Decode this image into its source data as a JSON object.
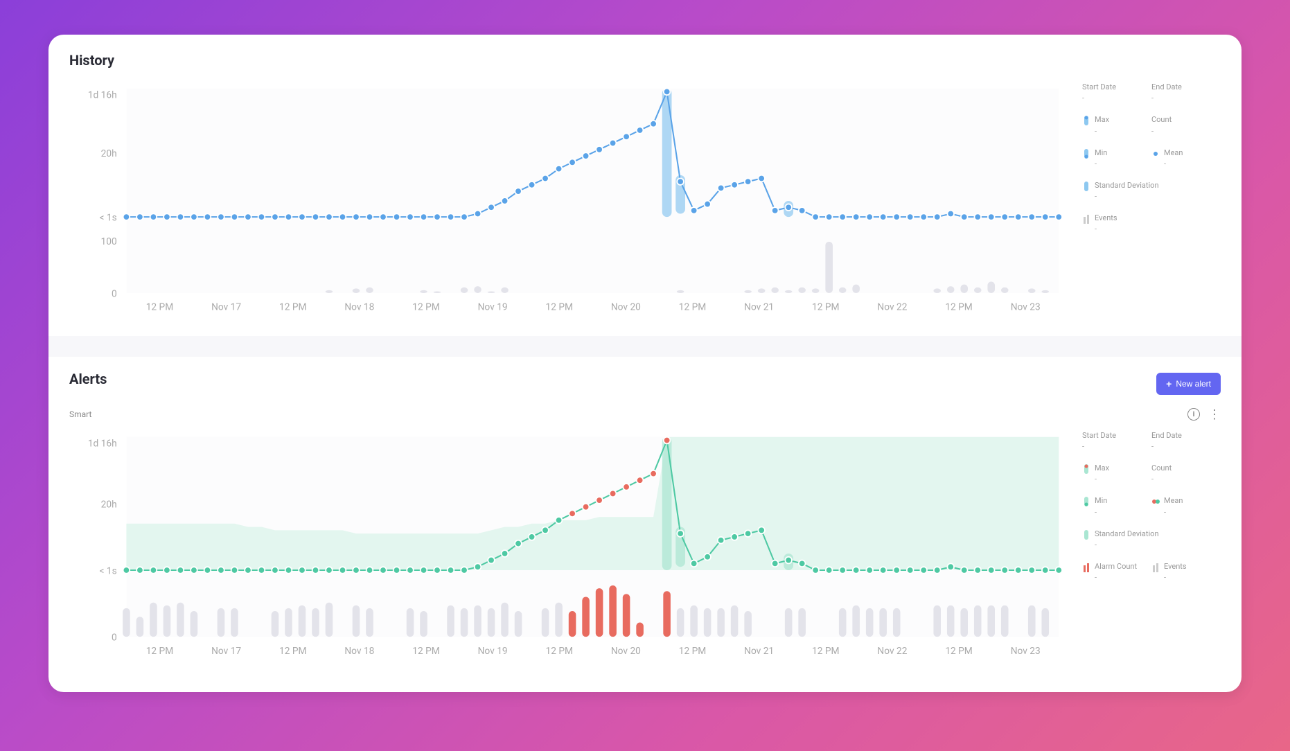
{
  "history": {
    "title": "History",
    "stats": {
      "start_date": {
        "label": "Start Date",
        "value": "-"
      },
      "end_date": {
        "label": "End Date",
        "value": "-"
      },
      "max": {
        "label": "Max",
        "value": "-"
      },
      "count": {
        "label": "Count",
        "value": "-"
      },
      "min": {
        "label": "Min",
        "value": "-"
      },
      "mean": {
        "label": "Mean",
        "value": "-"
      },
      "stddev": {
        "label": "Standard Deviation",
        "value": "-"
      },
      "events": {
        "label": "Events",
        "value": "-"
      }
    }
  },
  "alerts": {
    "title": "Alerts",
    "new_alert_label": "New alert",
    "subheader": "Smart",
    "stats": {
      "start_date": {
        "label": "Start Date",
        "value": "-"
      },
      "end_date": {
        "label": "End Date",
        "value": "-"
      },
      "max": {
        "label": "Max",
        "value": "-"
      },
      "count": {
        "label": "Count",
        "value": "-"
      },
      "min": {
        "label": "Min",
        "value": "-"
      },
      "mean": {
        "label": "Mean",
        "value": "-"
      },
      "stddev": {
        "label": "Standard Deviation",
        "value": "-"
      },
      "alarm_count": {
        "label": "Alarm Count",
        "value": "-"
      },
      "events": {
        "label": "Events",
        "value": "-"
      }
    }
  },
  "chart_data": [
    {
      "type": "line",
      "title": "History",
      "x_labels": [
        "12 PM",
        "Nov 17",
        "12 PM",
        "Nov 18",
        "12 PM",
        "Nov 19",
        "12 PM",
        "Nov 20",
        "12 PM",
        "Nov 21",
        "12 PM",
        "Nov 22",
        "12 PM",
        "Nov 23"
      ],
      "y_ticks": [
        "1d 16h",
        "20h",
        "< 1s"
      ],
      "events_y_ticks": [
        100,
        0
      ],
      "series": [
        {
          "name": "Mean (hours)",
          "color": "#5aa3e8",
          "values": [
            0,
            0,
            0,
            0,
            0,
            0,
            0,
            0,
            0,
            0,
            0,
            0,
            0,
            0,
            0,
            0,
            0,
            0,
            0,
            0,
            0,
            0,
            0,
            0,
            0,
            0,
            1,
            3,
            5,
            8,
            10,
            12,
            15,
            17,
            19,
            21,
            23,
            25,
            27,
            29,
            39,
            11,
            2,
            4,
            9,
            10,
            11,
            12,
            2,
            3,
            2,
            0,
            0,
            0,
            0,
            0,
            0,
            0,
            0,
            0,
            0,
            1,
            0,
            0,
            0,
            0,
            0,
            0,
            0,
            0
          ]
        }
      ],
      "stddev_bars": [
        {
          "index": 40,
          "low": -4,
          "high": 40
        },
        {
          "index": 41,
          "low": 1,
          "high": 13
        },
        {
          "index": 49,
          "low": 0,
          "high": 5
        }
      ],
      "events_bars": [
        0,
        0,
        0,
        0,
        0,
        0,
        0,
        0,
        0,
        0,
        0,
        0,
        0,
        0,
        0,
        5,
        0,
        8,
        10,
        0,
        0,
        0,
        5,
        3,
        0,
        10,
        12,
        3,
        10,
        0,
        0,
        0,
        0,
        0,
        0,
        0,
        0,
        0,
        0,
        0,
        0,
        5,
        0,
        0,
        0,
        0,
        5,
        8,
        10,
        5,
        10,
        8,
        90,
        10,
        15,
        0,
        0,
        0,
        0,
        0,
        8,
        12,
        15,
        10,
        20,
        10,
        0,
        8,
        5,
        0
      ]
    },
    {
      "type": "line",
      "title": "Alerts",
      "x_labels": [
        "12 PM",
        "Nov 17",
        "12 PM",
        "Nov 18",
        "12 PM",
        "Nov 19",
        "12 PM",
        "Nov 20",
        "12 PM",
        "Nov 21",
        "12 PM",
        "Nov 22",
        "12 PM",
        "Nov 23"
      ],
      "y_ticks": [
        "1d 16h",
        "20h",
        "< 1s"
      ],
      "events_y_ticks": [
        0
      ],
      "alert_band_upper": [
        14,
        14,
        14,
        14,
        14,
        14,
        14,
        14,
        14,
        13,
        13,
        12,
        12,
        12,
        12,
        12,
        12,
        11,
        11,
        11,
        11,
        11,
        11,
        11,
        11,
        11,
        11,
        12,
        13,
        13,
        14,
        14,
        15,
        15,
        15,
        16,
        16,
        16,
        16,
        16,
        40,
        40,
        40,
        40,
        40,
        40,
        40,
        40,
        40,
        40,
        40,
        40,
        40,
        40,
        40,
        40,
        40,
        40,
        40,
        40,
        40,
        40,
        40,
        40,
        40,
        40,
        40,
        40,
        40,
        40
      ],
      "series": [
        {
          "name": "Mean (hours)",
          "color_normal": "#4ec9a3",
          "color_alarm": "#e86b5f",
          "values": [
            0,
            0,
            0,
            0,
            0,
            0,
            0,
            0,
            0,
            0,
            0,
            0,
            0,
            0,
            0,
            0,
            0,
            0,
            0,
            0,
            0,
            0,
            0,
            0,
            0,
            0,
            1,
            3,
            5,
            8,
            10,
            12,
            15,
            17,
            19,
            21,
            23,
            25,
            27,
            29,
            39,
            11,
            2,
            4,
            9,
            10,
            11,
            12,
            2,
            3,
            2,
            0,
            0,
            0,
            0,
            0,
            0,
            0,
            0,
            0,
            0,
            1,
            0,
            0,
            0,
            0,
            0,
            0,
            0,
            0
          ],
          "alarm_indices": [
            33,
            34,
            35,
            36,
            37,
            38,
            39,
            40
          ]
        }
      ],
      "stddev_bars": [
        {
          "index": 40,
          "low": -4,
          "high": 40
        },
        {
          "index": 41,
          "low": 1,
          "high": 13
        },
        {
          "index": 49,
          "low": 0,
          "high": 5
        }
      ],
      "alarm_bars": [
        0,
        0,
        0,
        0,
        0,
        0,
        0,
        0,
        0,
        0,
        0,
        0,
        0,
        0,
        0,
        0,
        0,
        0,
        0,
        0,
        0,
        0,
        0,
        0,
        0,
        0,
        0,
        0,
        0,
        0,
        0,
        0,
        0,
        45,
        70,
        85,
        90,
        75,
        25,
        0,
        80,
        0,
        0,
        0,
        0,
        0,
        0,
        0,
        0,
        0,
        0,
        0,
        0,
        0,
        0,
        0,
        0,
        0,
        0,
        0,
        0,
        0,
        0,
        0,
        0,
        0,
        0,
        0,
        0,
        0
      ],
      "events_bars": [
        50,
        35,
        60,
        55,
        60,
        45,
        0,
        50,
        50,
        0,
        0,
        45,
        50,
        55,
        50,
        60,
        0,
        55,
        50,
        0,
        0,
        50,
        45,
        0,
        55,
        50,
        55,
        50,
        60,
        45,
        0,
        50,
        60,
        0,
        0,
        0,
        0,
        0,
        0,
        0,
        0,
        50,
        55,
        50,
        50,
        55,
        45,
        0,
        0,
        50,
        50,
        0,
        0,
        50,
        55,
        50,
        50,
        50,
        0,
        0,
        55,
        55,
        50,
        55,
        55,
        55,
        0,
        55,
        50,
        0
      ]
    }
  ]
}
